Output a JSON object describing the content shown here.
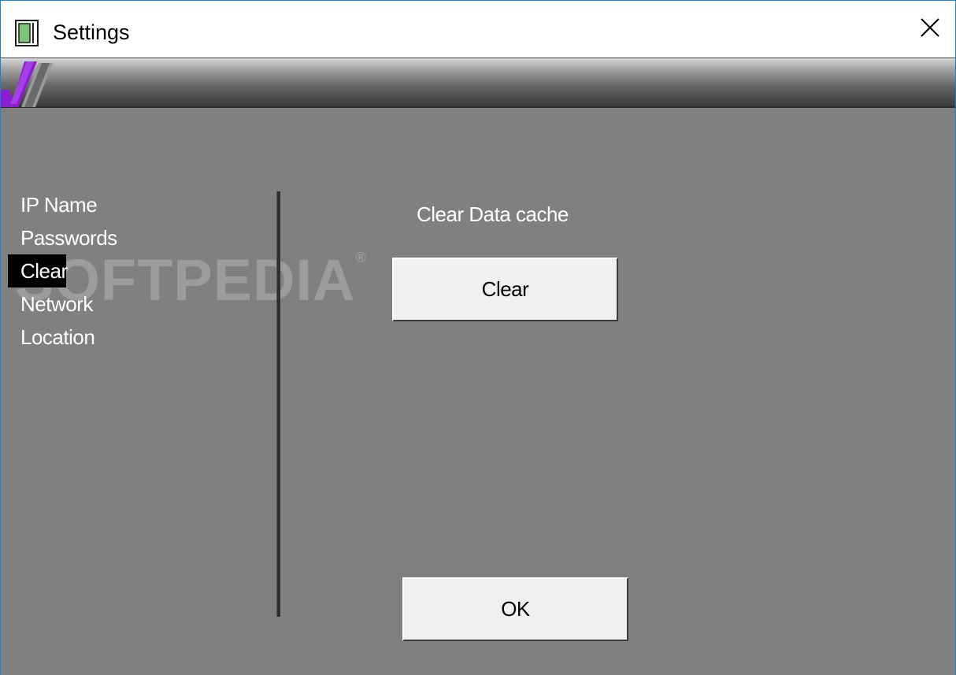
{
  "window": {
    "title": "Settings"
  },
  "titlebar": {
    "app_icon": "document-window-icon",
    "close_icon": "close-x-icon"
  },
  "banner": {
    "logo_icon": "purple-checkmark-logo"
  },
  "sidebar": {
    "items": [
      {
        "label": "IP Name",
        "selected": false
      },
      {
        "label": "Passwords",
        "selected": false
      },
      {
        "label": "Clear",
        "selected": true
      },
      {
        "label": "Network",
        "selected": false
      },
      {
        "label": "Location",
        "selected": false
      }
    ]
  },
  "main": {
    "section_label": "Clear Data cache",
    "clear_button_label": "Clear"
  },
  "footer": {
    "ok_button_label": "OK"
  },
  "watermark": {
    "text": "SOFTPEDIA",
    "mark": "®"
  },
  "colors": {
    "background": "#808080",
    "selected_item_bg": "#000000",
    "text": "#ffffff",
    "button_face": "#f0f0f0",
    "logo_accent": "#8a1fd1",
    "window_border": "#1a7fd4"
  }
}
